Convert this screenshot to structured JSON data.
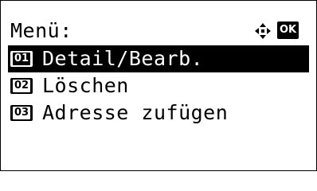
{
  "menu": {
    "title": "Menü:",
    "nav_icon": "four-way-arrow-icon",
    "ok_label": "OK",
    "items": [
      {
        "number": "01",
        "label": "Detail/Bearb.",
        "selected": true
      },
      {
        "number": "02",
        "label": "Löschen",
        "selected": false
      },
      {
        "number": "03",
        "label": "Adresse zufügen",
        "selected": false
      }
    ]
  },
  "colors": {
    "background": "#ffffff",
    "foreground": "#000000",
    "highlight": "#000000"
  }
}
